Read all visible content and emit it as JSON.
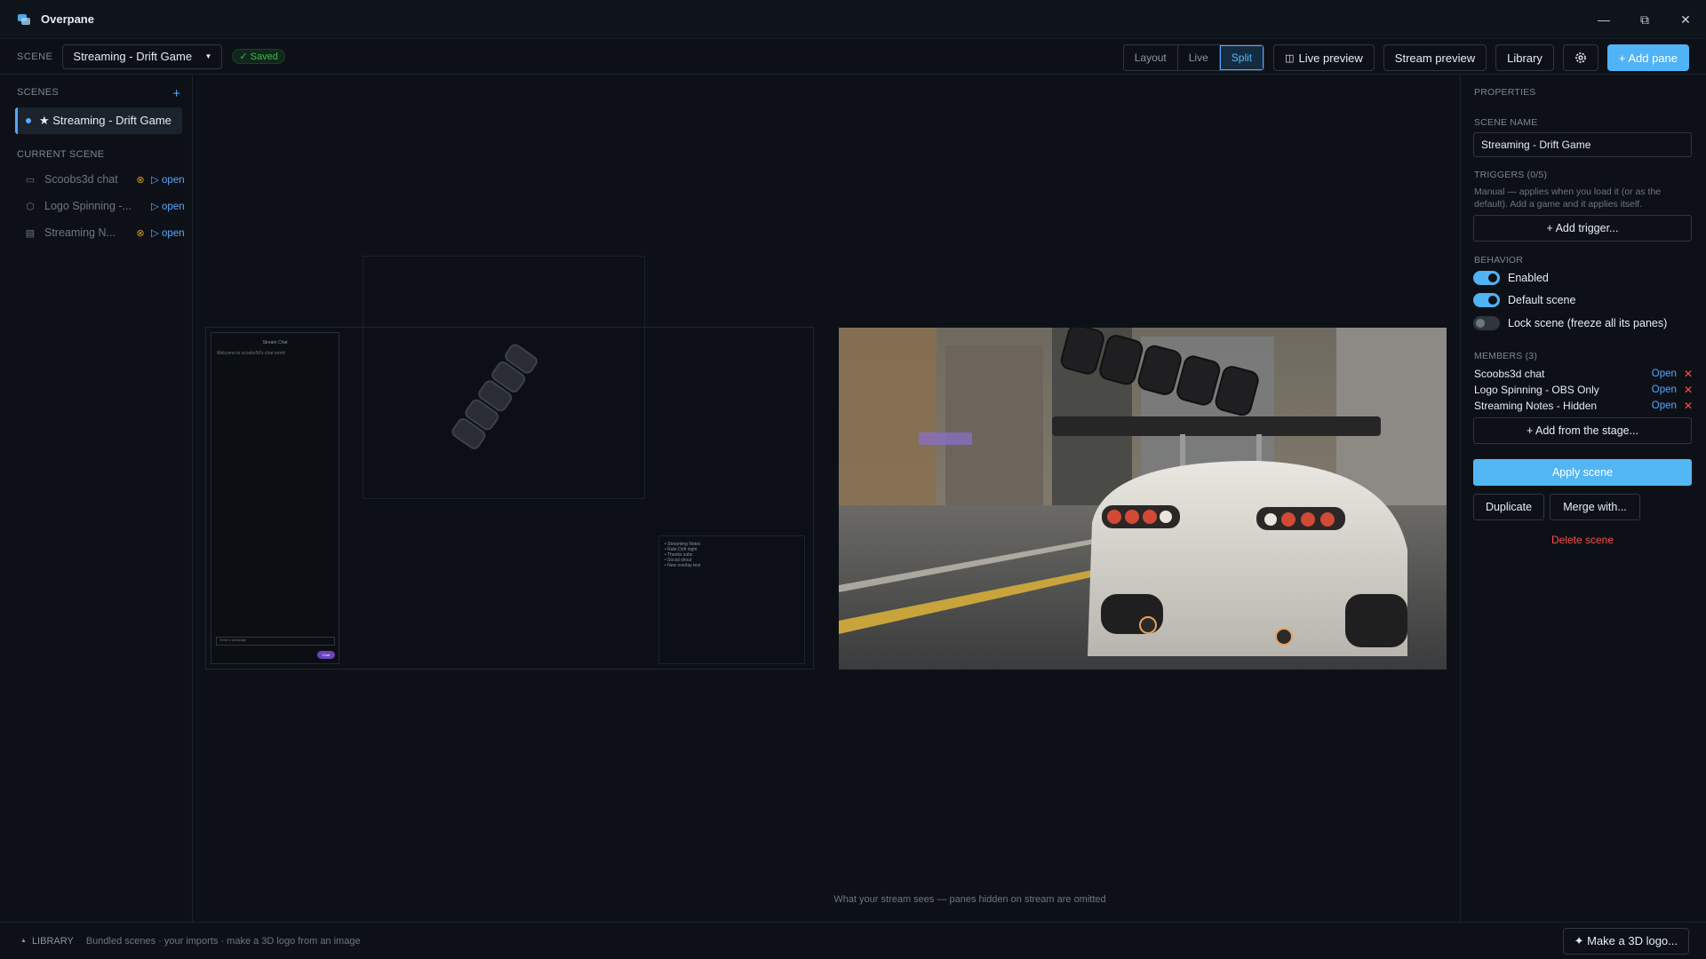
{
  "app": {
    "title": "Overpane"
  },
  "toolbar": {
    "scene_label": "SCENE",
    "scene_value": "Streaming - Drift Game",
    "saved_badge": "✓ Saved",
    "modes": [
      "Layout",
      "Live",
      "Split"
    ],
    "active_mode": "Split",
    "live_preview_label": "Live preview",
    "stream_preview_label": "Stream preview",
    "library_label": "Library",
    "add_pane_label": "+ Add pane"
  },
  "sidebar": {
    "scenes_heading": "SCENES",
    "add_icon": "+",
    "scenes": [
      {
        "label": "★ Streaming - Drift Game",
        "active": true
      }
    ],
    "current_scene_heading": "CURRENT SCENE",
    "members": [
      {
        "icon": "chat-icon",
        "name": "Scoobs3d chat",
        "warning": true,
        "open_label": "▷ open"
      },
      {
        "icon": "cube-icon",
        "name": "Logo Spinning -...",
        "warning": false,
        "open_label": "▷ open"
      },
      {
        "icon": "note-icon",
        "name": "Streaming N...",
        "warning": true,
        "open_label": "▷ open"
      }
    ]
  },
  "stage": {
    "chat_title": "Stream Chat",
    "chat_welcome": "Welcome to scoobs3d's chat room!",
    "chat_input_placeholder": "Send a message",
    "chat_send_label": "Chat",
    "notes_lines": [
      "• Streaming Notes",
      "• Rate Drift night",
      "• Thanks subs",
      "• Social shout",
      "• New overlay test"
    ],
    "caption": "What your stream sees — panes hidden on stream are omitted"
  },
  "properties": {
    "heading": "PROPERTIES",
    "scene_name_heading": "SCENE NAME",
    "scene_name_value": "Streaming - Drift Game",
    "triggers_heading": "TRIGGERS (0/5)",
    "triggers_help": "Manual — applies when you load it (or as the default). Add a game and it applies itself.",
    "add_trigger_label": "+ Add trigger...",
    "behavior_heading": "BEHAVIOR",
    "toggles": [
      {
        "label": "Enabled",
        "on": true
      },
      {
        "label": "Default scene",
        "on": true
      },
      {
        "label": "Lock scene (freeze all its panes)",
        "on": false
      }
    ],
    "members_heading": "MEMBERS (3)",
    "members": [
      {
        "name": "Scoobs3d chat",
        "open": "Open",
        "remove": "✕"
      },
      {
        "name": "Logo Spinning - OBS Only",
        "open": "Open",
        "remove": "✕"
      },
      {
        "name": "Streaming Notes - Hidden",
        "open": "Open",
        "remove": "✕"
      }
    ],
    "add_from_stage_label": "+ Add from the stage...",
    "apply_label": "Apply scene",
    "duplicate_label": "Duplicate",
    "merge_label": "Merge with...",
    "delete_label": "Delete scene"
  },
  "bottombar": {
    "library_label": "LIBRARY",
    "library_sub": "Bundled scenes · your imports · make a 3D logo from an image",
    "make_logo_label": "✦ Make a 3D logo..."
  },
  "colors": {
    "accent": "#4fb3f6",
    "danger": "#f85149",
    "warning": "#d29922",
    "success": "#3fb950"
  }
}
